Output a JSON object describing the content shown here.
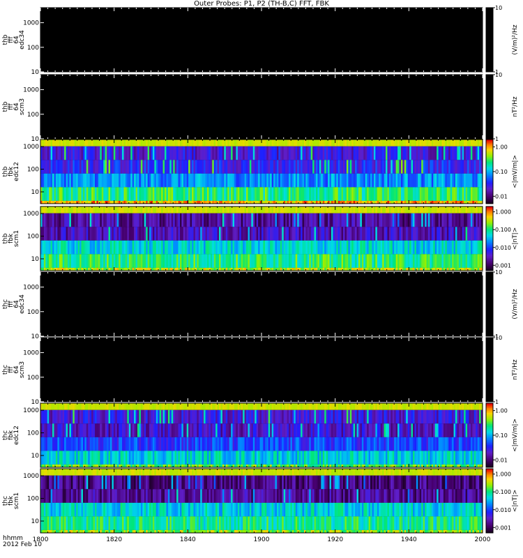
{
  "title": "Outer Probes: P1, P2 (TH-B,C) FFT, FBK",
  "time_axis": {
    "label_line1": "hhmm",
    "label_line2": "2012 Feb 10",
    "ticks": [
      "1800",
      "1820",
      "1840",
      "1900",
      "1920",
      "1940",
      "2000"
    ]
  },
  "chart_data": [
    {
      "type": "heatmap",
      "ylabel": [
        "thb",
        "fff",
        "64",
        "edc34"
      ],
      "y_ticks": [
        "1000",
        "100",
        "10"
      ],
      "ylog": true,
      "ylim": [
        10,
        4096
      ],
      "colorbar": {
        "ticks": [
          "10",
          "1"
        ],
        "label": "(V/m)²/Hz",
        "scale": "log",
        "range": [
          1,
          10
        ]
      },
      "fill": "no-data"
    },
    {
      "type": "heatmap",
      "ylabel": [
        "thb",
        "fff",
        "64",
        "scm3"
      ],
      "y_ticks": [
        "1000",
        "100",
        "10"
      ],
      "ylog": true,
      "ylim": [
        10,
        4096
      ],
      "colorbar": {
        "ticks": [
          "10",
          "1"
        ],
        "label": "nT²/Hz",
        "scale": "log",
        "range": [
          1,
          10
        ]
      },
      "fill": "no-data"
    },
    {
      "type": "heatmap",
      "ylabel": [
        "thb",
        "fbk",
        "edc12"
      ],
      "y_ticks": [
        "1000",
        "100",
        "10"
      ],
      "ylog": true,
      "ylim": [
        3,
        2048
      ],
      "colorbar": {
        "ticks": [
          "1.00",
          "0.10",
          "0.01"
        ],
        "label": "<|mV/m|>",
        "scale": "log",
        "range": [
          0.005,
          2
        ]
      },
      "bins": [
        2048,
        512,
        128,
        32,
        8,
        2
      ],
      "bin_levels": [
        0.8,
        0.25,
        0.3,
        0.45,
        0.65,
        0.88
      ],
      "fill": "data"
    },
    {
      "type": "heatmap",
      "ylabel": [
        "thb",
        "fbk",
        "scm1"
      ],
      "y_ticks": [
        "1000",
        "100",
        "10"
      ],
      "ylog": true,
      "ylim": [
        3,
        2048
      ],
      "colorbar": {
        "ticks": [
          "1.000",
          "0.100",
          "0.010",
          "0.001"
        ],
        "label": "<|nT|>",
        "scale": "log",
        "range": [
          0.0005,
          2
        ]
      },
      "bins": [
        2048,
        512,
        128,
        32,
        8,
        2
      ],
      "bin_levels": [
        0.8,
        0.15,
        0.2,
        0.55,
        0.65,
        0.78
      ],
      "fill": "data"
    },
    {
      "type": "heatmap",
      "ylabel": [
        "thc",
        "fff",
        "64",
        "edc34"
      ],
      "y_ticks": [
        "1000",
        "100",
        "10"
      ],
      "ylog": true,
      "ylim": [
        10,
        4096
      ],
      "colorbar": {
        "ticks": [
          "10",
          "1"
        ],
        "label": "(V/m)²/Hz",
        "scale": "log",
        "range": [
          1,
          10
        ]
      },
      "fill": "no-data"
    },
    {
      "type": "heatmap",
      "ylabel": [
        "thc",
        "fff",
        "64",
        "scm3"
      ],
      "y_ticks": [
        "1000",
        "100",
        "10"
      ],
      "ylog": true,
      "ylim": [
        10,
        4096
      ],
      "colorbar": {
        "ticks": [
          "10",
          "1"
        ],
        "label": "nT²/Hz",
        "scale": "log",
        "range": [
          1,
          10
        ]
      },
      "fill": "no-data"
    },
    {
      "type": "heatmap",
      "ylabel": [
        "thc",
        "fbk",
        "edc12"
      ],
      "y_ticks": [
        "1000",
        "100",
        "10"
      ],
      "ylog": true,
      "ylim": [
        3,
        2048
      ],
      "colorbar": {
        "ticks": [
          "1.00",
          "0.10",
          "0.01"
        ],
        "label": "<|mV/m|>",
        "scale": "log",
        "range": [
          0.005,
          2
        ]
      },
      "bins": [
        2048,
        512,
        128,
        32,
        8,
        2
      ],
      "bin_levels": [
        0.8,
        0.25,
        0.22,
        0.35,
        0.55,
        0.7
      ],
      "fill": "data"
    },
    {
      "type": "heatmap",
      "ylabel": [
        "thc",
        "fbk",
        "scm1"
      ],
      "y_ticks": [
        "1000",
        "100",
        "10"
      ],
      "ylog": true,
      "ylim": [
        3,
        2048
      ],
      "colorbar": {
        "ticks": [
          "1.000",
          "0.100",
          "0.010",
          "0.001"
        ],
        "label": "<|nT|>",
        "scale": "log",
        "range": [
          0.0005,
          2
        ]
      },
      "bins": [
        2048,
        512,
        128,
        32,
        8,
        2
      ],
      "bin_levels": [
        0.8,
        0.12,
        0.15,
        0.55,
        0.62,
        0.75
      ],
      "fill": "data"
    }
  ]
}
